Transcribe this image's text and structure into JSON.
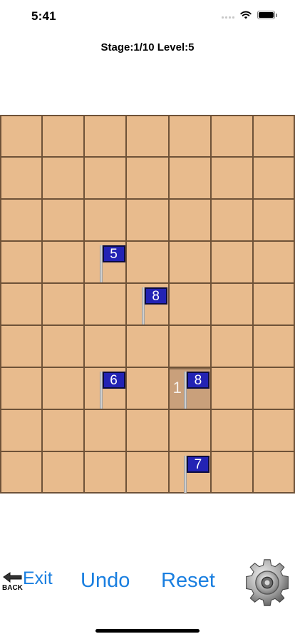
{
  "status_bar": {
    "time": "5:41"
  },
  "header": {
    "stage_label": "Stage:1/10 Level:5"
  },
  "board": {
    "columns": 7,
    "rows": 9,
    "highlighted_cell": {
      "row": 6,
      "col": 4,
      "number": "1"
    },
    "flags": [
      {
        "row": 3,
        "col": 2,
        "number": "5"
      },
      {
        "row": 4,
        "col": 3,
        "number": "8"
      },
      {
        "row": 6,
        "col": 2,
        "number": "6"
      },
      {
        "row": 6,
        "col": 4,
        "number": "8"
      },
      {
        "row": 8,
        "col": 4,
        "number": "7"
      }
    ]
  },
  "controls": {
    "back_label": "BACK",
    "exit_label": "Exit",
    "undo_label": "Undo",
    "reset_label": "Reset",
    "settings_icon": "gear-icon"
  },
  "colors": {
    "board": "#e8bb8d",
    "grid_lines": "#6e5238",
    "flag": "#2323b4",
    "link": "#1a7fe0"
  }
}
